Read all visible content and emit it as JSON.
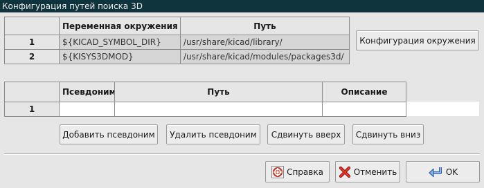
{
  "window": {
    "title": "Конфигурация путей поиска 3D"
  },
  "env_table": {
    "columns": [
      "Переменная окружения",
      "Путь"
    ],
    "rows": [
      {
        "index": "1",
        "name": "${KICAD_SYMBOL_DIR}",
        "path": "/usr/share/kicad/library/"
      },
      {
        "index": "2",
        "name": "${KISYS3DMOD}",
        "path": "/usr/share/kicad/modules/packages3d/"
      }
    ]
  },
  "env_config_button": {
    "label": "Конфигурация окружения"
  },
  "alias_table": {
    "columns": [
      "Псевдоним",
      "Путь",
      "Описание"
    ],
    "rows": [
      {
        "index": "1",
        "alias": "",
        "path": "",
        "description": ""
      }
    ]
  },
  "alias_buttons": {
    "add": "Добавить псевдоним",
    "remove": "Удалить псевдоним",
    "move_up": "Сдвинуть вверх",
    "move_down": "Сдвинуть вниз"
  },
  "footer_buttons": {
    "help": "Справка",
    "cancel": "Отменить",
    "ok": "OK"
  },
  "icons": {
    "help": "lifebuoy-icon",
    "cancel": "red-x-icon",
    "ok": "enter-arrow-icon"
  }
}
